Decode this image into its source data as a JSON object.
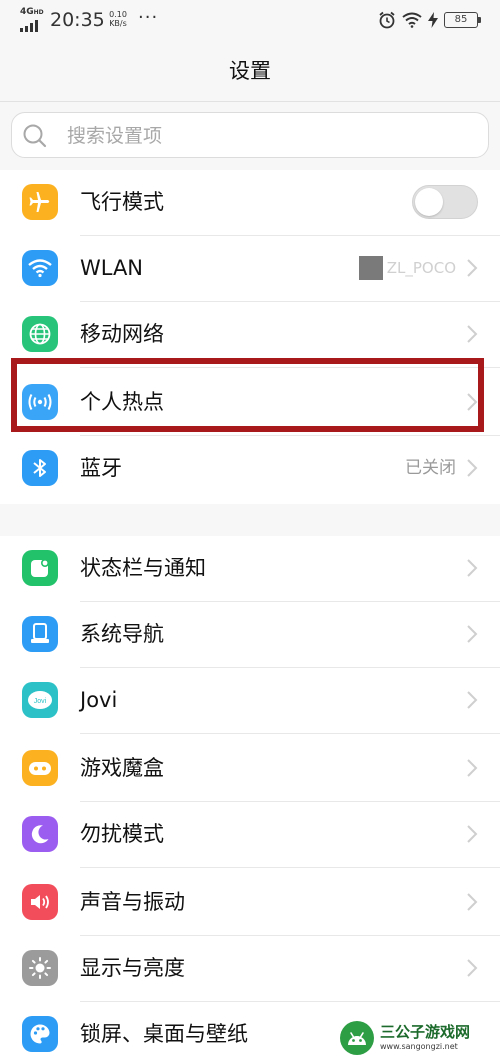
{
  "status_bar": {
    "network": "4G",
    "network_sup": "HD",
    "time": "20:35",
    "speed_value": "0.10",
    "speed_unit": "KB/s",
    "more": "···",
    "battery": "85",
    "icons": [
      "alarm-icon",
      "wifi-icon",
      "charging-icon",
      "battery-icon"
    ]
  },
  "header": {
    "title": "设置"
  },
  "search": {
    "placeholder": "搜索设置项",
    "icon": "search-icon"
  },
  "group_1": {
    "items": [
      {
        "label": "飞行模式",
        "icon": "airplane-icon",
        "color": "#fbb120",
        "control": "toggle",
        "toggle_on": false
      },
      {
        "label": "WLAN",
        "icon": "wifi-icon",
        "color": "#2d9cf5",
        "value": "ZL_POCO"
      },
      {
        "label": "移动网络",
        "icon": "globe-icon",
        "color": "#27c47a"
      },
      {
        "label": "个人热点",
        "icon": "hotspot-icon",
        "color": "#3aa5f7",
        "highlighted": true
      },
      {
        "label": "蓝牙",
        "icon": "bluetooth-icon",
        "color": "#2d9cf5",
        "value": "已关闭"
      }
    ]
  },
  "group_2": {
    "items": [
      {
        "label": "状态栏与通知",
        "icon": "notification-icon",
        "color": "#22c26a"
      },
      {
        "label": "系统导航",
        "icon": "navigation-icon",
        "color": "#2d9cf5"
      },
      {
        "label": "Jovi",
        "icon": "jovi-icon",
        "color": "#2bc1c6"
      },
      {
        "label": "游戏魔盒",
        "icon": "gamepad-icon",
        "color": "#fbb120"
      },
      {
        "label": "勿扰模式",
        "icon": "moon-icon",
        "color": "#9b5cf0"
      },
      {
        "label": "声音与振动",
        "icon": "speaker-icon",
        "color": "#f24d5a"
      },
      {
        "label": "显示与亮度",
        "icon": "sun-icon",
        "color": "#9b9b9b"
      },
      {
        "label": "锁屏、桌面与壁纸",
        "icon": "palette-icon",
        "color": "#2d9cf5"
      }
    ]
  },
  "highlight_color": "#a8191b",
  "watermark": {
    "title": "三公子游戏网",
    "url": "www.sangongzi.net"
  }
}
